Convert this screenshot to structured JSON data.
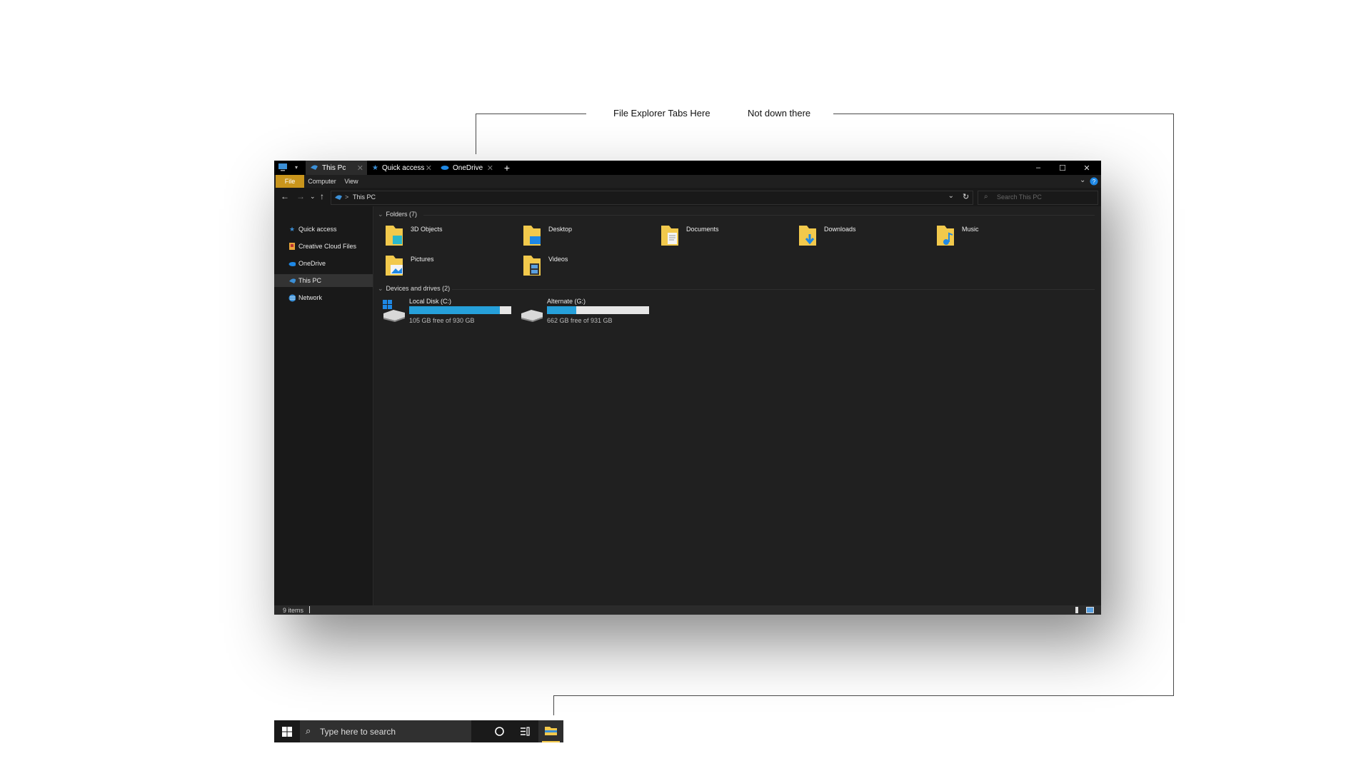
{
  "annotations": {
    "tabs_here": "File Explorer Tabs Here",
    "not_down": "Not down there"
  },
  "explorer": {
    "tabs": [
      {
        "label": "This Pc",
        "icon": "this-pc-icon"
      },
      {
        "label": "Quick access",
        "icon": "star-icon"
      },
      {
        "label": "OneDrive",
        "icon": "cloud-icon"
      }
    ],
    "new_tab": "+",
    "window_controls": {
      "minimize": "–",
      "maximize": "☐",
      "close": "✕"
    },
    "ribbon_tabs": [
      "File",
      "Computer",
      "View"
    ],
    "address": {
      "crumb": "This PC",
      "separator": ">"
    },
    "search_placeholder": "Search This PC",
    "nav_items": [
      {
        "label": "Quick access",
        "icon": "star-icon"
      },
      {
        "label": "Creative Cloud Files",
        "icon": "creative-cloud-icon"
      },
      {
        "label": "OneDrive",
        "icon": "cloud-icon"
      },
      {
        "label": "This PC",
        "icon": "this-pc-icon",
        "selected": true
      },
      {
        "label": "Network",
        "icon": "network-icon"
      }
    ],
    "folders_header": "Folders (7)",
    "folders": [
      "3D Objects",
      "Desktop",
      "Documents",
      "Downloads",
      "Music",
      "Pictures",
      "Videos"
    ],
    "devices_header": "Devices and drives (2)",
    "drives": [
      {
        "label": "Local Disk (C:)",
        "free": "105 GB free of 930 GB",
        "used_fraction": 0.887
      },
      {
        "label": "Alternate (G:)",
        "free": "662 GB free of 931 GB",
        "used_fraction": 0.289
      }
    ],
    "status": "9 items",
    "colors": {
      "accent": "#26a0da",
      "file_tab": "#c9951c",
      "folder": "#f2c94c"
    }
  },
  "taskbar": {
    "search_placeholder": "Type here to search"
  }
}
